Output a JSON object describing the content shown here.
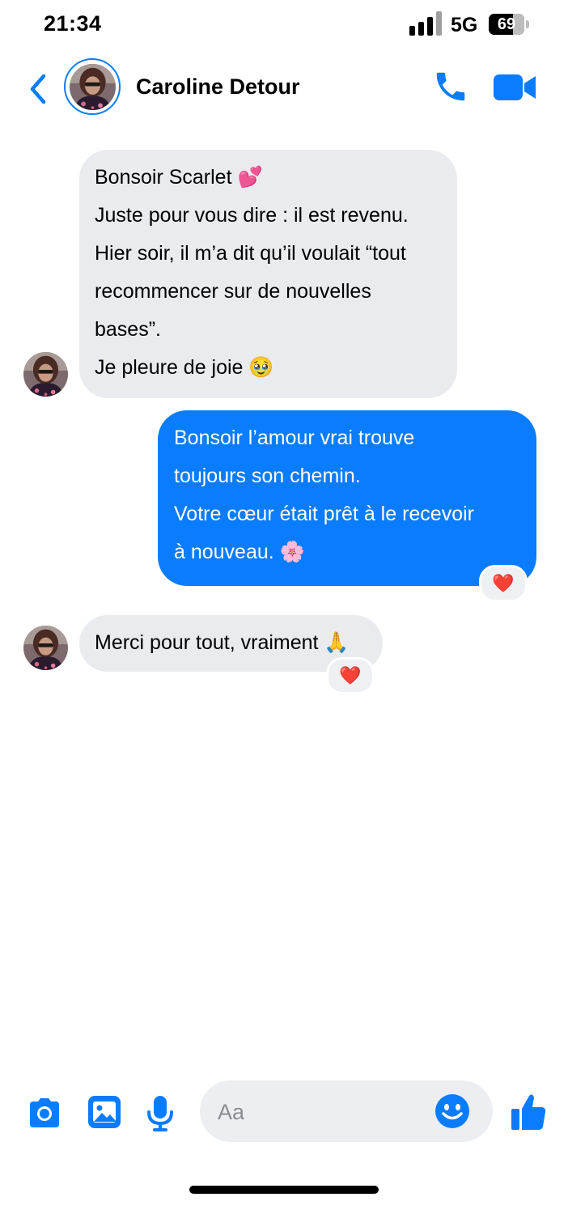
{
  "status_bar": {
    "time": "21:34",
    "network": "5G",
    "battery": "69",
    "battery_level": 0.69
  },
  "header": {
    "contact_name": "Caroline Detour",
    "icons": [
      "chevron-left-icon",
      "avatar",
      "phone-icon",
      "video-camera-icon"
    ]
  },
  "messages": [
    {
      "direction": "incoming",
      "lines": [
        "Bonsoir Scarlet 💕",
        "Juste pour vous dire : il est revenu.",
        "Hier soir, il m’a dit qu’il voulait “tout",
        "recommencer sur de nouvelles",
        "bases”.",
        "Je pleure de joie 🥹"
      ],
      "reaction": ""
    },
    {
      "direction": "outgoing",
      "lines": [
        "Bonsoir l’amour vrai trouve",
        "toujours son chemin.",
        "Votre cœur était prêt à le recevoir",
        "à nouveau. 🌸"
      ],
      "reaction": "❤️"
    },
    {
      "direction": "incoming",
      "lines": [
        "Merci pour tout, vraiment 🙏"
      ],
      "reaction": "❤️"
    }
  ],
  "composer": {
    "placeholder": "Aa",
    "icons": [
      "camera-icon",
      "image-icon",
      "microphone-icon",
      "emoji-icon",
      "thumbs-up-icon"
    ]
  },
  "colors": {
    "accent": "#0a7cff",
    "incoming_bubble": "#e9ebef",
    "reaction_heart": "#e8132f"
  }
}
